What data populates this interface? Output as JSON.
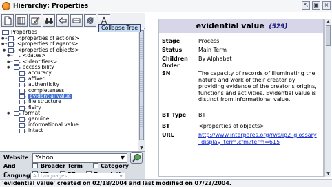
{
  "window": {
    "title": "Hierarchy: Properties",
    "controls": [
      "restore-icon",
      "maximize-icon",
      "close-icon"
    ]
  },
  "toolbar": {
    "buttons": [
      "new-document-icon",
      "columns-icon",
      "edit-icon",
      "binoculars-icon",
      "back-arrow-icon",
      "collapse-icon",
      "refresh-icon",
      "font-icon"
    ],
    "tooltip": "Collapse Tree"
  },
  "tree": {
    "root": "Properties",
    "items": [
      {
        "label": "<properties of actions>",
        "level": 1,
        "expander": "o-"
      },
      {
        "label": "<properties of agents>",
        "level": 1,
        "expander": "o-"
      },
      {
        "label": "<properties of objects>",
        "level": 1,
        "expander": "o"
      },
      {
        "label": "<dates>",
        "level": 2,
        "expander": "o-"
      },
      {
        "label": "<identifiers>",
        "level": 2,
        "expander": "o-"
      },
      {
        "label": "accessibility",
        "level": 2,
        "expander": "o-"
      },
      {
        "label": "accuracy",
        "level": 3,
        "expander": ""
      },
      {
        "label": "affixed",
        "level": 3,
        "expander": ""
      },
      {
        "label": "authenticity",
        "level": 3,
        "expander": ""
      },
      {
        "label": "completeness",
        "level": 3,
        "expander": ""
      },
      {
        "label": "evidential value",
        "level": 3,
        "expander": "",
        "selected": true
      },
      {
        "label": "file structure",
        "level": 3,
        "expander": ""
      },
      {
        "label": "fixity",
        "level": 3,
        "expander": ""
      },
      {
        "label": "format",
        "level": 2,
        "expander": "o-"
      },
      {
        "label": "genuine",
        "level": 3,
        "expander": ""
      },
      {
        "label": "informational value",
        "level": 3,
        "expander": ""
      },
      {
        "label": "intact",
        "level": 3,
        "expander": ""
      }
    ]
  },
  "filters": {
    "website_label": "Website",
    "website_value": "Yahoo",
    "and_label": "And",
    "or_label": "Or",
    "language_label": "Language",
    "language_value": "All Languages",
    "checkboxes": {
      "broader_term": "Broader Term",
      "category": "Category",
      "uf": "UF",
      "rt": "RT",
      "translation": "Translation"
    }
  },
  "term": {
    "title": "evidential value",
    "count": "(529)",
    "properties": [
      {
        "key": "Stage",
        "value": "Process"
      },
      {
        "key": "Status",
        "value": "Main Term"
      },
      {
        "key": "Children Order",
        "value": "By Alphabet"
      },
      {
        "key": "SN",
        "value": "The capacity of records of illuminating the nature and work of their creator by providing evidence of the creator's origins, functions and activities. Evidential value is distinct from informational value."
      },
      {
        "key": "BT Type",
        "value": "BT"
      },
      {
        "key": "BT",
        "value": "<properties of objects>"
      },
      {
        "key": "URL",
        "value": "http://www.interpares.org/rws/ip2_glossary_display_term.cfm?term=615"
      }
    ]
  },
  "status": {
    "text": "'evidential value' created on 02/18/2004 and last modified on 07/23/2004."
  },
  "colors": {
    "selection": "#3d6fd6",
    "term_header": "#d6d6e8",
    "link": "#1a2fd0"
  }
}
